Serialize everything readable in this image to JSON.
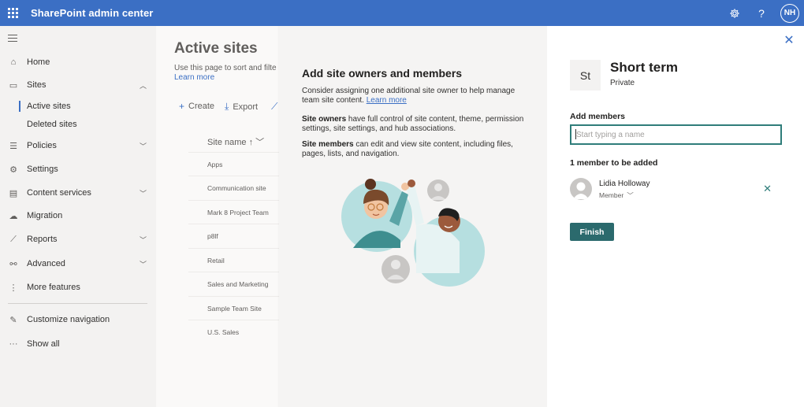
{
  "topbar": {
    "app_title": "SharePoint admin center",
    "settings_icon": "gear-icon",
    "help_label": "?",
    "user_initials": "NH"
  },
  "nav": {
    "items": [
      {
        "label": "Home",
        "icon": "home-icon"
      },
      {
        "label": "Sites",
        "icon": "sites-icon",
        "expanded": true
      },
      {
        "label": "Policies",
        "icon": "policies-icon",
        "expanded": false
      },
      {
        "label": "Settings",
        "icon": "settings-icon"
      },
      {
        "label": "Content services",
        "icon": "content-services-icon",
        "expanded": false
      },
      {
        "label": "Migration",
        "icon": "migration-icon"
      },
      {
        "label": "Reports",
        "icon": "reports-icon",
        "expanded": false
      },
      {
        "label": "Advanced",
        "icon": "advanced-icon",
        "expanded": false
      },
      {
        "label": "More features",
        "icon": "more-features-icon"
      },
      {
        "label": "Customize navigation",
        "icon": "pencil-icon"
      },
      {
        "label": "Show all",
        "icon": "ellipsis-icon"
      }
    ],
    "sites_children": [
      {
        "label": "Active sites",
        "selected": true
      },
      {
        "label": "Deleted sites",
        "selected": false
      }
    ]
  },
  "page": {
    "title": "Active sites",
    "description": "Use this page to sort and filte",
    "learn_more": "Learn more",
    "commands": [
      "Create",
      "Export"
    ],
    "column_header": "Site name ↑",
    "rows": [
      "Apps",
      "Communication site",
      "Mark 8 Project Team",
      "p8lf",
      "Retail",
      "Sales and Marketing",
      "Sample Team Site",
      "U.S. Sales"
    ]
  },
  "panel": {
    "heading": "Add site owners and members",
    "intro": "Consider assigning one additional site owner to help manage team site content.",
    "intro_link": "Learn more",
    "owners_term": "Site owners",
    "owners_text": "have full control of site content, theme, permission settings, site settings, and hub associations.",
    "members_term": "Site members",
    "members_text": "can edit and view site content, including files, pages, lists, and navigation.",
    "site_initials": "St",
    "site_name": "Short term",
    "site_privacy": "Private",
    "add_members_label": "Add members",
    "search_placeholder": "Start typing a name",
    "count_label": "1 member to be added",
    "member": {
      "name": "Lidia Holloway",
      "role": "Member"
    },
    "finish_label": "Finish"
  },
  "colors": {
    "brand": "#3b6fc4",
    "teal": "#2b6a6d",
    "nav_bg": "#f3f2f1"
  }
}
